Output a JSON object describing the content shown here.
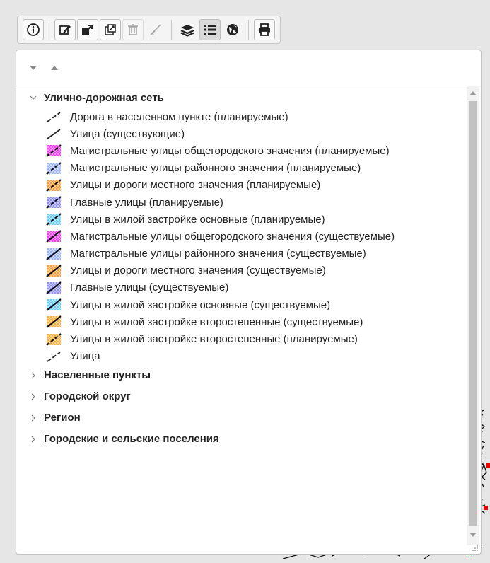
{
  "toolbar": {
    "buttons": [
      {
        "icon": "info-icon"
      },
      {
        "icon": "edit-icon"
      },
      {
        "icon": "layer-move-icon"
      },
      {
        "icon": "open-external-icon"
      },
      {
        "icon": "trash-icon"
      },
      {
        "icon": "measure-icon"
      },
      {
        "icon": "layers-icon"
      },
      {
        "icon": "legend-list-icon"
      },
      {
        "icon": "globe-icon"
      },
      {
        "icon": "print-icon"
      }
    ]
  },
  "legend": {
    "groups": [
      {
        "label": "Улично-дорожная сеть",
        "expanded": true,
        "items": [
          {
            "label": "Дорога в населенном пункте (планируемые)",
            "symbol": "dash-line",
            "color": "#222222"
          },
          {
            "label": "Улица (существующие)",
            "symbol": "solid-line",
            "color": "#222222"
          },
          {
            "label": "Магистральные улицы общегородского значения (планируемые)",
            "symbol": "hatch-dash",
            "color": "#ff33ff"
          },
          {
            "label": "Магистральные улицы районного значения (планируемые)",
            "symbol": "hatch-dash",
            "color": "#99b3ff"
          },
          {
            "label": "Улицы и дороги местного значения (планируемые)",
            "symbol": "hatch-dash",
            "color": "#ff9933"
          },
          {
            "label": "Главные улицы (планируемые)",
            "symbol": "hatch-dash",
            "color": "#8c8cff"
          },
          {
            "label": "Улицы в жилой застройке основные (планируемые)",
            "symbol": "hatch-dash",
            "color": "#66ccff"
          },
          {
            "label": "Магистральные улицы общегородского значения (существуемые)",
            "symbol": "hatch-solid",
            "color": "#ff33ff"
          },
          {
            "label": "Магистральные улицы районного значения (существуемые)",
            "symbol": "hatch-solid",
            "color": "#99b3ff"
          },
          {
            "label": "Улицы и дороги местного значения (существуемые)",
            "symbol": "hatch-solid",
            "color": "#ff9933"
          },
          {
            "label": "Главные улицы (существуемые)",
            "symbol": "hatch-solid",
            "color": "#8c8cff"
          },
          {
            "label": "Улицы в жилой застройке основные (существуемые)",
            "symbol": "hatch-solid",
            "color": "#66ccff"
          },
          {
            "label": "Улицы в жилой застройке второстепенные (существуемые)",
            "symbol": "hatch-solid",
            "color": "#ffaa33"
          },
          {
            "label": "Улицы в жилой застройке второстепенные (планируемые)",
            "symbol": "hatch-dash",
            "color": "#ffaa33"
          },
          {
            "label": "Улица",
            "symbol": "dash-line",
            "color": "#222222"
          }
        ]
      },
      {
        "label": "Населенные пункты",
        "expanded": false
      },
      {
        "label": "Городской округ",
        "expanded": false
      },
      {
        "label": "Регион",
        "expanded": false
      },
      {
        "label": "Городские и сельские поселения",
        "expanded": false
      }
    ]
  }
}
